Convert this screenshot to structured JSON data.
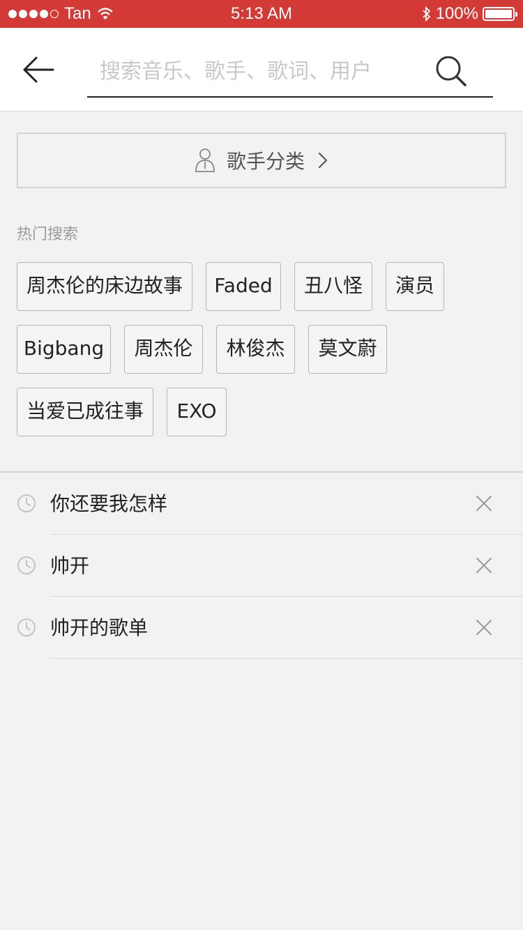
{
  "status_bar": {
    "carrier": "Tan",
    "time": "5:13 AM",
    "battery": "100%"
  },
  "search": {
    "placeholder": "搜索音乐、歌手、歌词、用户",
    "value": ""
  },
  "singer_category": {
    "label": "歌手分类"
  },
  "hot_search": {
    "title": "热门搜索",
    "tags": [
      "周杰伦的床边故事",
      "Faded",
      "丑八怪",
      "演员",
      "Bigbang",
      "周杰伦",
      "林俊杰",
      "莫文蔚",
      "当爱已成往事",
      "EXO"
    ]
  },
  "history": {
    "items": [
      "你还要我怎样",
      "帅开",
      "帅开的歌单"
    ]
  },
  "colors": {
    "status_bar": "#d33a36",
    "background": "#f2f2f2"
  },
  "icons": {
    "back": "arrow-left-icon",
    "search": "magnifier-icon",
    "singer": "person-icon",
    "chevron": "chevron-right-icon",
    "clock": "clock-icon",
    "delete": "close-icon"
  }
}
